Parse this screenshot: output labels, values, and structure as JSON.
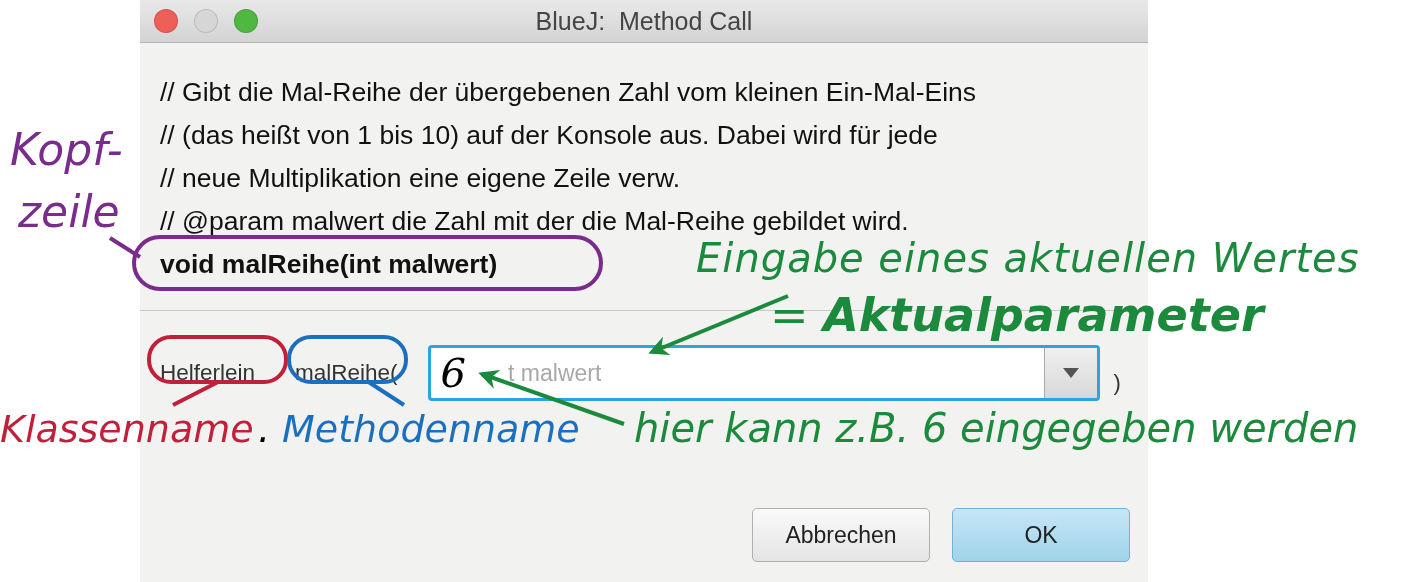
{
  "window": {
    "title": "BlueJ:  Method Call",
    "controls": [
      {
        "color": "#ee5f58"
      },
      {
        "color": "#d6d6d6"
      },
      {
        "color": "#4fb840"
      }
    ]
  },
  "comment_lines": [
    "// Gibt die Mal-Reihe der übergebenen Zahl vom kleinen Ein-Mal-Eins",
    "// (das heißt von 1 bis 10) auf der Konsole aus. Dabei wird für jede",
    "// neue Multiplikation eine eigene Zeile verw.",
    "// @param malwert die Zahl mit der die Mal-Reihe gebildet wird."
  ],
  "signature": "void malReihe(int malwert)",
  "call": {
    "class_name": "Helferlein",
    "method_name": "malReihe(",
    "argument": {
      "handwritten": "6",
      "placeholder": "t malwert"
    },
    "closing": ")"
  },
  "buttons": [
    {
      "label": "Abbrechen",
      "kind": "secondary"
    },
    {
      "label": "OK",
      "kind": "primary"
    }
  ],
  "annotations": [
    {
      "text": "Kopf-",
      "color": "#7a2c8c"
    },
    {
      "text": "zeile",
      "color": "#7a2c8c"
    },
    {
      "text": "Eingabe eines aktuellen Wertes",
      "color": "#1b8a3c"
    },
    {
      "text": "= **Aktualparameter**",
      "color": "#1b8a3c"
    },
    {
      "text": "Klassenname",
      "color": "#c21f3a"
    },
    {
      "text": ".",
      "color": "#000000"
    },
    {
      "text": "Methodenname",
      "color": "#1a6fbe"
    },
    {
      "text": "hier kann z.B. 6 eingegeben werden",
      "color": "#1b8a3c"
    }
  ]
}
